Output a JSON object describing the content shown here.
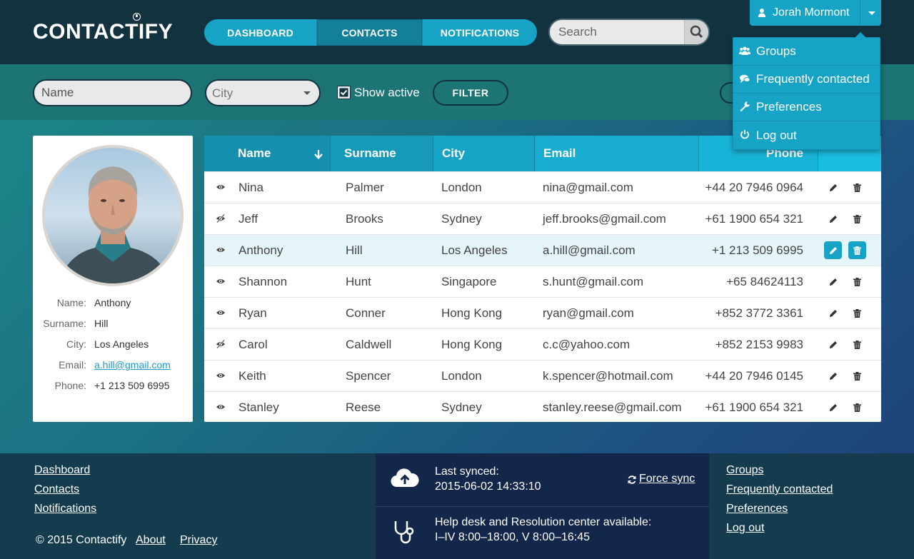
{
  "app": {
    "logo": "CONTACTIFY"
  },
  "nav": {
    "tabs": [
      "DASHBOARD",
      "CONTACTS",
      "NOTIFICATIONS"
    ],
    "active": "CONTACTS"
  },
  "search": {
    "placeholder": "Search"
  },
  "user": {
    "name": "Jorah Mormont"
  },
  "user_menu": [
    {
      "label": "Groups",
      "icon": "users-icon"
    },
    {
      "label": "Frequently contacted",
      "icon": "chat-icon"
    },
    {
      "label": "Preferences",
      "icon": "wrench-icon"
    },
    {
      "label": "Log out",
      "icon": "power-icon"
    }
  ],
  "filters": {
    "name_placeholder": "Name",
    "city_placeholder": "City",
    "show_active_label": "Show active",
    "show_active_checked": true,
    "filter_button": "FILTER"
  },
  "profile": {
    "rows": [
      {
        "key": "Name:",
        "value": "Anthony"
      },
      {
        "key": "Surname:",
        "value": "Hill"
      },
      {
        "key": "City:",
        "value": "Los Angeles"
      },
      {
        "key": "Email:",
        "value": "a.hill@gmail.com"
      },
      {
        "key": "Phone:",
        "value": "+1 213 509 6995"
      }
    ]
  },
  "table": {
    "columns": [
      "Name",
      "Surname",
      "City",
      "Email",
      "Phone"
    ],
    "sorted_by": "Name",
    "rows": [
      {
        "visible": true,
        "name": "Nina",
        "surname": "Palmer",
        "city": "London",
        "email": "nina@gmail.com",
        "phone": "+44 20 7946 0964"
      },
      {
        "visible": false,
        "name": "Jeff",
        "surname": "Brooks",
        "city": "Sydney",
        "email": "jeff.brooks@gmail.com",
        "phone": "+61 1900 654 321"
      },
      {
        "visible": true,
        "name": "Anthony",
        "surname": "Hill",
        "city": "Los Angeles",
        "email": "a.hill@gmail.com",
        "phone": "+1 213 509 6995",
        "selected": true
      },
      {
        "visible": true,
        "name": "Shannon",
        "surname": "Hunt",
        "city": "Singapore",
        "email": "s.hunt@gmail.com",
        "phone": "+65 84624113"
      },
      {
        "visible": true,
        "name": "Ryan",
        "surname": "Conner",
        "city": "Hong Kong",
        "email": "ryan@gmail.com",
        "phone": "+852 3772 3361"
      },
      {
        "visible": false,
        "name": "Carol",
        "surname": "Caldwell",
        "city": "Hong Kong",
        "email": "c.c@yahoo.com",
        "phone": "+852 2153 9983"
      },
      {
        "visible": true,
        "name": "Keith",
        "surname": "Spencer",
        "city": "London",
        "email": "k.spencer@hotmail.com",
        "phone": "+44 20 7946 0145"
      },
      {
        "visible": true,
        "name": "Stanley",
        "surname": "Reese",
        "city": "Sydney",
        "email": "stanley.reese@gmail.com",
        "phone": "+61 1900 654 321"
      }
    ]
  },
  "footer": {
    "left_links": [
      "Dashboard",
      "Contacts",
      "Notifications"
    ],
    "copyright": "© 2015 Contactify",
    "about": "About",
    "privacy": "Privacy",
    "sync_label": "Last synced:",
    "sync_time": "2015-06-02 14:33:10",
    "force_sync": "Force sync",
    "help_title": "Help desk and Resolution center available:",
    "help_hours": "I–IV 8:00–18:00, V 8:00–16:45",
    "right_links": [
      "Groups",
      "Frequently contacted",
      "Preferences",
      "Log out"
    ]
  },
  "colors": {
    "accent": "#17a3c5",
    "header": "#12323f",
    "footer": "#153c4e",
    "footer_mid": "#12274a"
  }
}
